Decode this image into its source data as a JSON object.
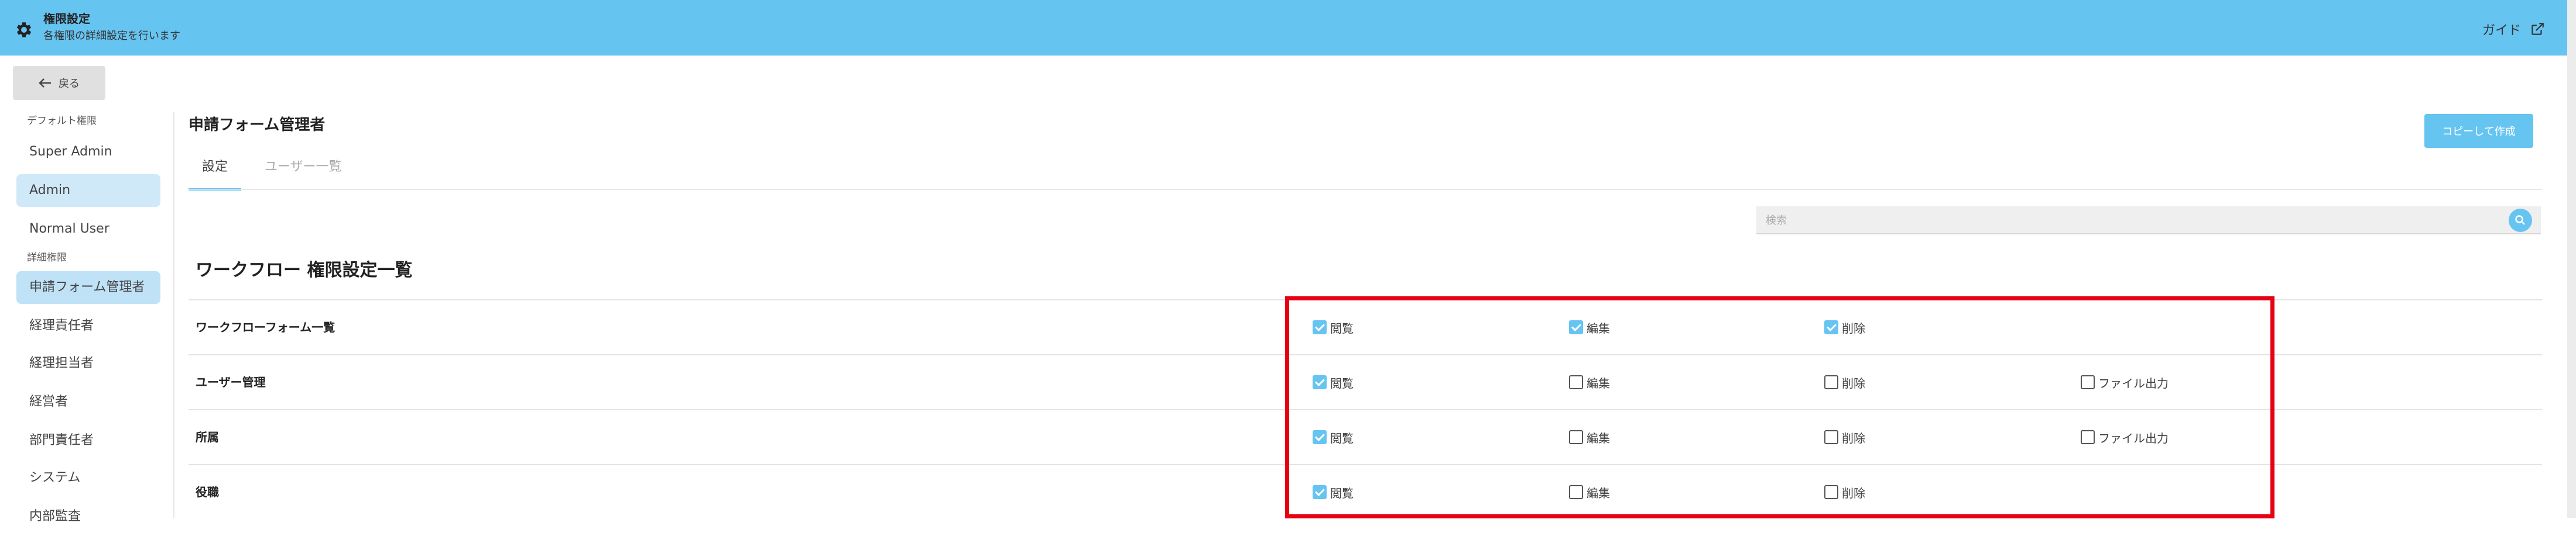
{
  "header": {
    "title": "権限設定",
    "subtitle": "各権限の詳細設定を行います",
    "guide_label": "ガイド",
    "color": "#66c4f1"
  },
  "back_button": {
    "label": "戻る"
  },
  "sidebar": {
    "section_default": "デフォルト権限",
    "default_items": [
      {
        "label": "Super Admin"
      },
      {
        "label": "Admin"
      },
      {
        "label": "Normal User"
      }
    ],
    "section_detail": "詳細権限",
    "detail_items": [
      {
        "label": "申請フォーム管理者"
      },
      {
        "label": "経理責任者"
      },
      {
        "label": "経理担当者"
      },
      {
        "label": "経営者"
      },
      {
        "label": "部門責任者"
      },
      {
        "label": "システム"
      },
      {
        "label": "内部監査"
      }
    ]
  },
  "main": {
    "title": "申請フォーム管理者",
    "tabs": [
      {
        "label": "設定"
      },
      {
        "label": "ユーザー一覧"
      }
    ],
    "copy_button": "コピーして作成",
    "search_placeholder": "検索",
    "section_title": "ワークフロー 権限設定一覧",
    "rows": [
      {
        "label": "ワークフローフォーム一覧",
        "perms": [
          {
            "label": "閲覧",
            "checked": true
          },
          {
            "label": "編集",
            "checked": true
          },
          {
            "label": "削除",
            "checked": true
          }
        ]
      },
      {
        "label": "ユーザー管理",
        "perms": [
          {
            "label": "閲覧",
            "checked": true
          },
          {
            "label": "編集",
            "checked": false
          },
          {
            "label": "削除",
            "checked": false
          },
          {
            "label": "ファイル出力",
            "checked": false
          }
        ]
      },
      {
        "label": "所属",
        "perms": [
          {
            "label": "閲覧",
            "checked": true
          },
          {
            "label": "編集",
            "checked": false
          },
          {
            "label": "削除",
            "checked": false
          },
          {
            "label": "ファイル出力",
            "checked": false
          }
        ]
      },
      {
        "label": "役職",
        "perms": [
          {
            "label": "閲覧",
            "checked": true
          },
          {
            "label": "編集",
            "checked": false
          },
          {
            "label": "削除",
            "checked": false
          }
        ]
      }
    ]
  },
  "colors": {
    "accent": "#66c4f1",
    "highlight": "#e60012"
  },
  "icons": {
    "header": "gear-icon",
    "guide": "external-link-icon",
    "back": "arrow-left-icon",
    "search": "search-icon"
  }
}
